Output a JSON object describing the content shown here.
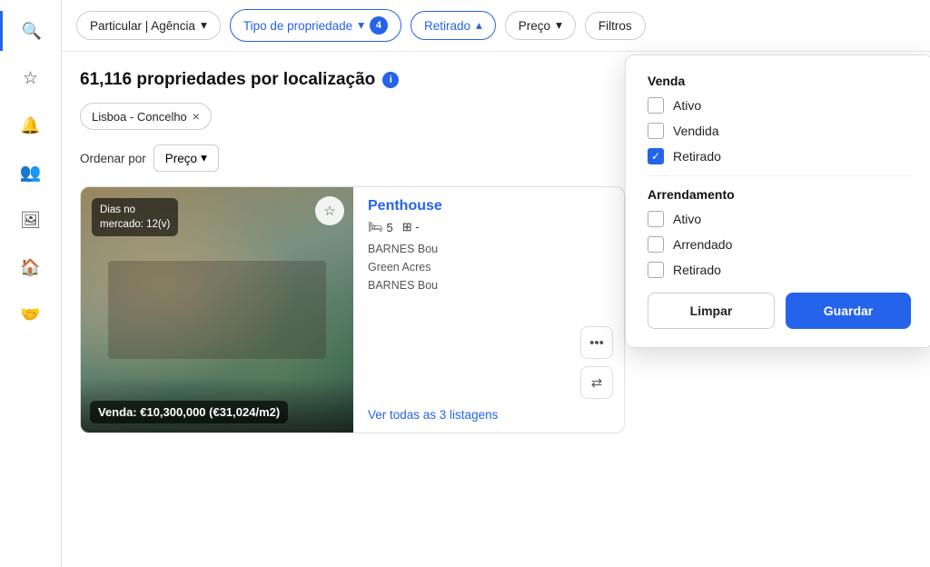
{
  "sidebar": {
    "items": [
      {
        "label": "Search",
        "icon": "🔍",
        "name": "search"
      },
      {
        "label": "Favorites",
        "icon": "☆",
        "name": "favorites"
      },
      {
        "label": "Notifications",
        "icon": "🔔",
        "name": "notifications"
      },
      {
        "label": "Contacts",
        "icon": "👥",
        "name": "contacts"
      },
      {
        "label": "Gallery",
        "icon": "🖼",
        "name": "gallery"
      },
      {
        "label": "Home",
        "icon": "🏠",
        "name": "home"
      },
      {
        "label": "Partners",
        "icon": "🤝",
        "name": "partners"
      }
    ]
  },
  "topbar": {
    "filter1_label": "Particular | Agência",
    "filter2_label": "Tipo de propriedade",
    "filter2_badge": "4",
    "filter3_label": "Retirado",
    "filter4_label": "Preço",
    "filter5_label": "Filtros"
  },
  "content": {
    "title": "61,116 propriedades por localização",
    "tag_label": "Lisboa - Concelho",
    "sort_label": "Ordenar por",
    "sort_value": "Preço"
  },
  "card": {
    "badge_line1": "Dias no",
    "badge_line2": "mercado: 12(v)",
    "title": "Penthouse",
    "price": "Venda: €10,300,000 (€31,024/m2)",
    "beds": "5",
    "agent1": "BARNES Bou",
    "agent2": "Green Acres",
    "agent3": "BARNES Bou",
    "view_all": "Ver todas as 3 listagens"
  },
  "dropdown": {
    "section1_title": "Venda",
    "item1_label": "Ativo",
    "item1_checked": false,
    "item2_label": "Vendida",
    "item2_checked": false,
    "item3_label": "Retirado",
    "item3_checked": true,
    "section2_title": "Arrendamento",
    "item4_label": "Ativo",
    "item4_checked": false,
    "item5_label": "Arrendado",
    "item5_checked": false,
    "item6_label": "Retirado",
    "item6_checked": false,
    "btn_clear": "Limpar",
    "btn_save": "Guardar"
  },
  "icons": {
    "chevron_down": "▾",
    "chevron_up": "▴",
    "close": "×",
    "star": "☆",
    "dots": "•••",
    "share": "⇄",
    "check": "✓",
    "info": "i"
  }
}
